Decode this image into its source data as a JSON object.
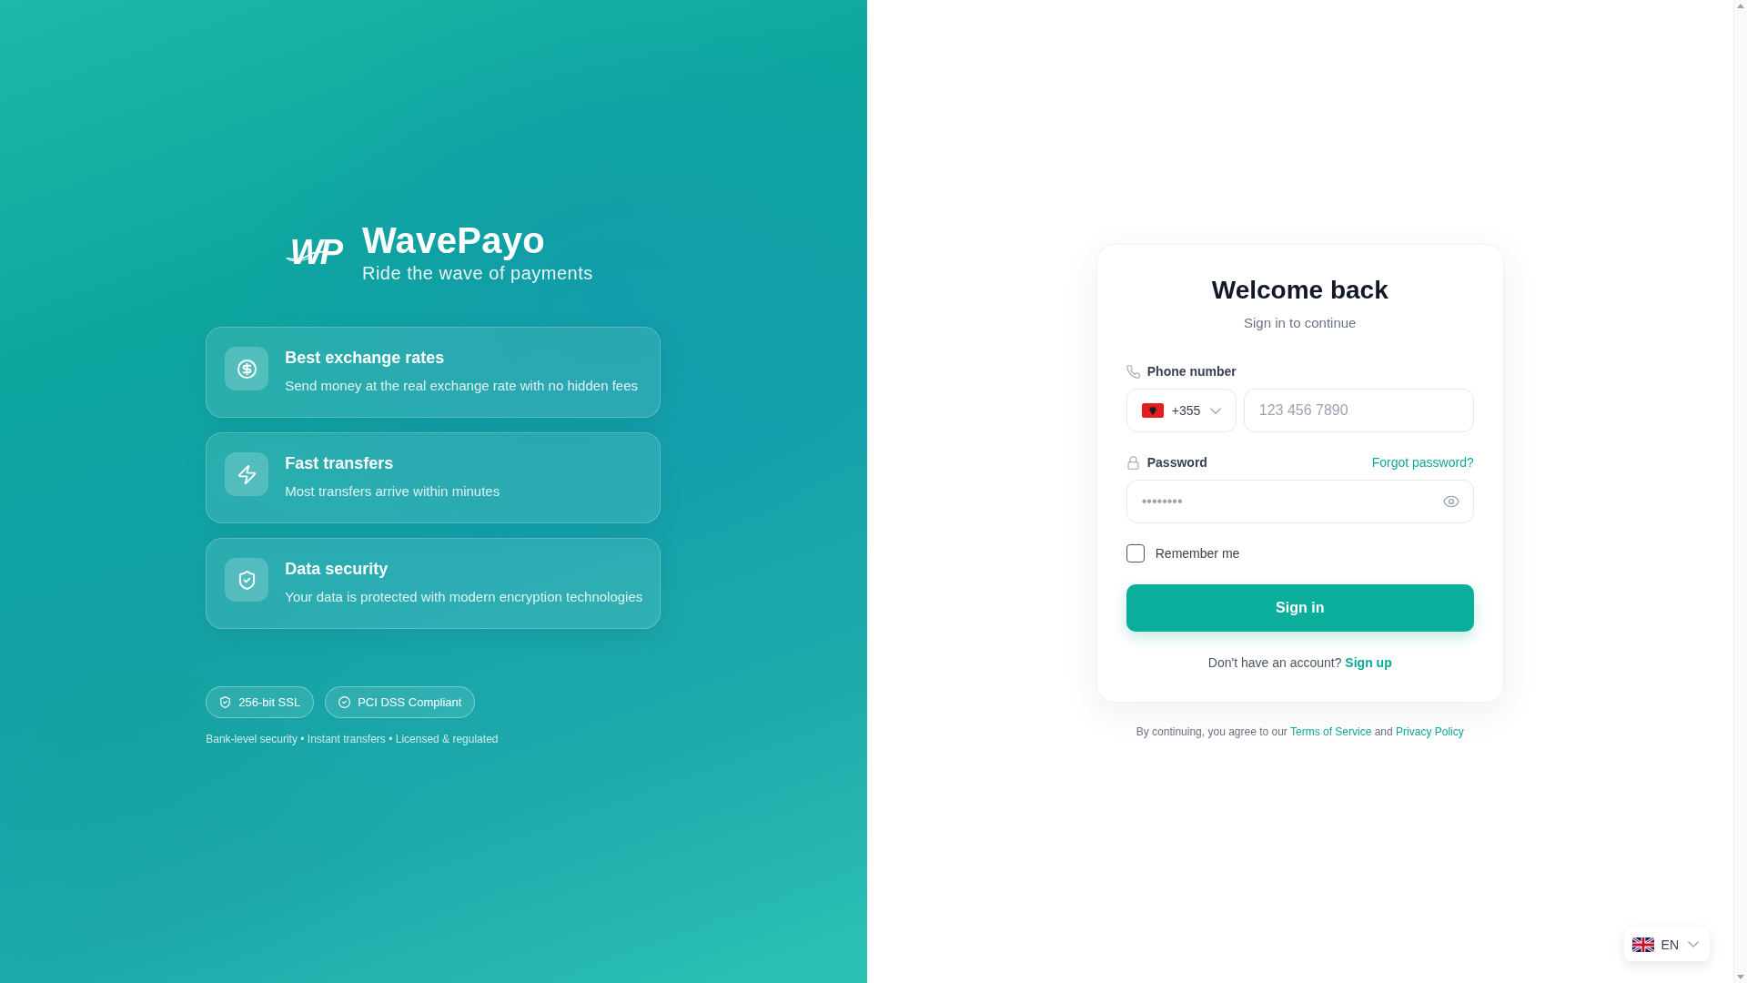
{
  "brand": {
    "logo_text": "WP",
    "name": "WavePayo",
    "tagline": "Ride the wave of payments"
  },
  "features": [
    {
      "title": "Best exchange rates",
      "description": "Send money at the real exchange rate with no hidden fees"
    },
    {
      "title": "Fast transfers",
      "description": "Most transfers arrive within minutes"
    },
    {
      "title": "Data security",
      "description": "Your data is protected with modern encryption technologies"
    }
  ],
  "badges": [
    "256-bit SSL",
    "PCI DSS Compliant"
  ],
  "trust_line": "Bank-level security • Instant transfers • Licensed & regulated",
  "login": {
    "title": "Welcome back",
    "subtitle": "Sign in to continue",
    "phone": {
      "label": "Phone number",
      "country_code": "+355",
      "placeholder": "123 456 7890"
    },
    "password": {
      "label": "Password",
      "placeholder": "••••••••",
      "forgot_link": "Forgot password?"
    },
    "remember": {
      "label": "Remember me",
      "checked": false
    },
    "submit": "Sign in",
    "signup": {
      "prompt": "Don't have an account?",
      "link": "Sign up"
    }
  },
  "legal": {
    "text": "By continuing, you agree to our",
    "terms_link": "Terms of Service",
    "joiner": "and",
    "privacy_link": "Privacy Policy"
  },
  "language": {
    "code": "EN"
  }
}
